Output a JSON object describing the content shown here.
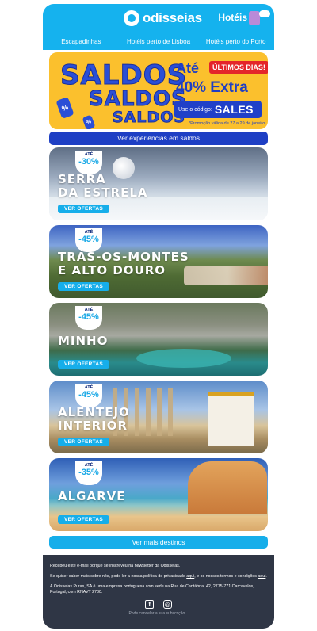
{
  "header": {
    "brand": "odisseias",
    "hoteis_label": "Hotéis"
  },
  "nav": {
    "items": [
      "Escapadinhas",
      "Hotéis perto de Lisboa",
      "Hotéis perto do Porto"
    ]
  },
  "banner": {
    "saldos": "SALDOS",
    "ate": "Até",
    "ultimos_dias": "ÚLTIMOS DIAS!",
    "extra": "40% Extra",
    "codigo_label": "Use o código:",
    "codigo": "SALES",
    "promo_note": "*Promoção válida de 27 a 29 de janeiro."
  },
  "cta_top": "Ver experiências em saldos",
  "cards": [
    {
      "ate": "ATÉ",
      "discount": "-30%",
      "title_line1": "SERRA",
      "title_line2": "DA ESTRELA",
      "button": "VER OFERTAS"
    },
    {
      "ate": "ATÉ",
      "discount": "-45%",
      "title_line1": "TRÁS-OS-MONTES",
      "title_line2": "E ALTO DOURO",
      "button": "VER OFERTAS"
    },
    {
      "ate": "ATÉ",
      "discount": "-45%",
      "title_line1": "MINHO",
      "title_line2": "",
      "button": "VER OFERTAS"
    },
    {
      "ate": "ATÉ",
      "discount": "-45%",
      "title_line1": "ALENTEJO",
      "title_line2": "INTERIOR",
      "button": "VER OFERTAS"
    },
    {
      "ate": "ATÉ",
      "discount": "-35%",
      "title_line1": "ALGARVE",
      "title_line2": "",
      "button": "VER OFERTAS"
    }
  ],
  "cta_bottom": "Ver mais destinos",
  "footer": {
    "line1": "Recebeu este e-mail porque se inscreveu na newsletter da Odisseias.",
    "line2_a": "Se quiser saber mais sobre nós, pode ler a nossa política de privacidade ",
    "line2_link1": "aqui",
    "line2_b": ", e os nossos termos e condições ",
    "line2_link2": "aqui",
    "line2_c": ".",
    "line3": "A Odisseias Puras, SA é uma empresa portuguesa com sede na Rua de Cantábria, 42, 2775-771 Carcavelos, Portugal, com RNAVT 2780.",
    "unsubscribe": "Pode cancelar a sua subscrição..."
  },
  "colors": {
    "brand_blue": "#15b2ee",
    "banner_yellow": "#fbc02d",
    "cta_dark_blue": "#1e3fc4",
    "footer_bg": "#2f3645"
  }
}
